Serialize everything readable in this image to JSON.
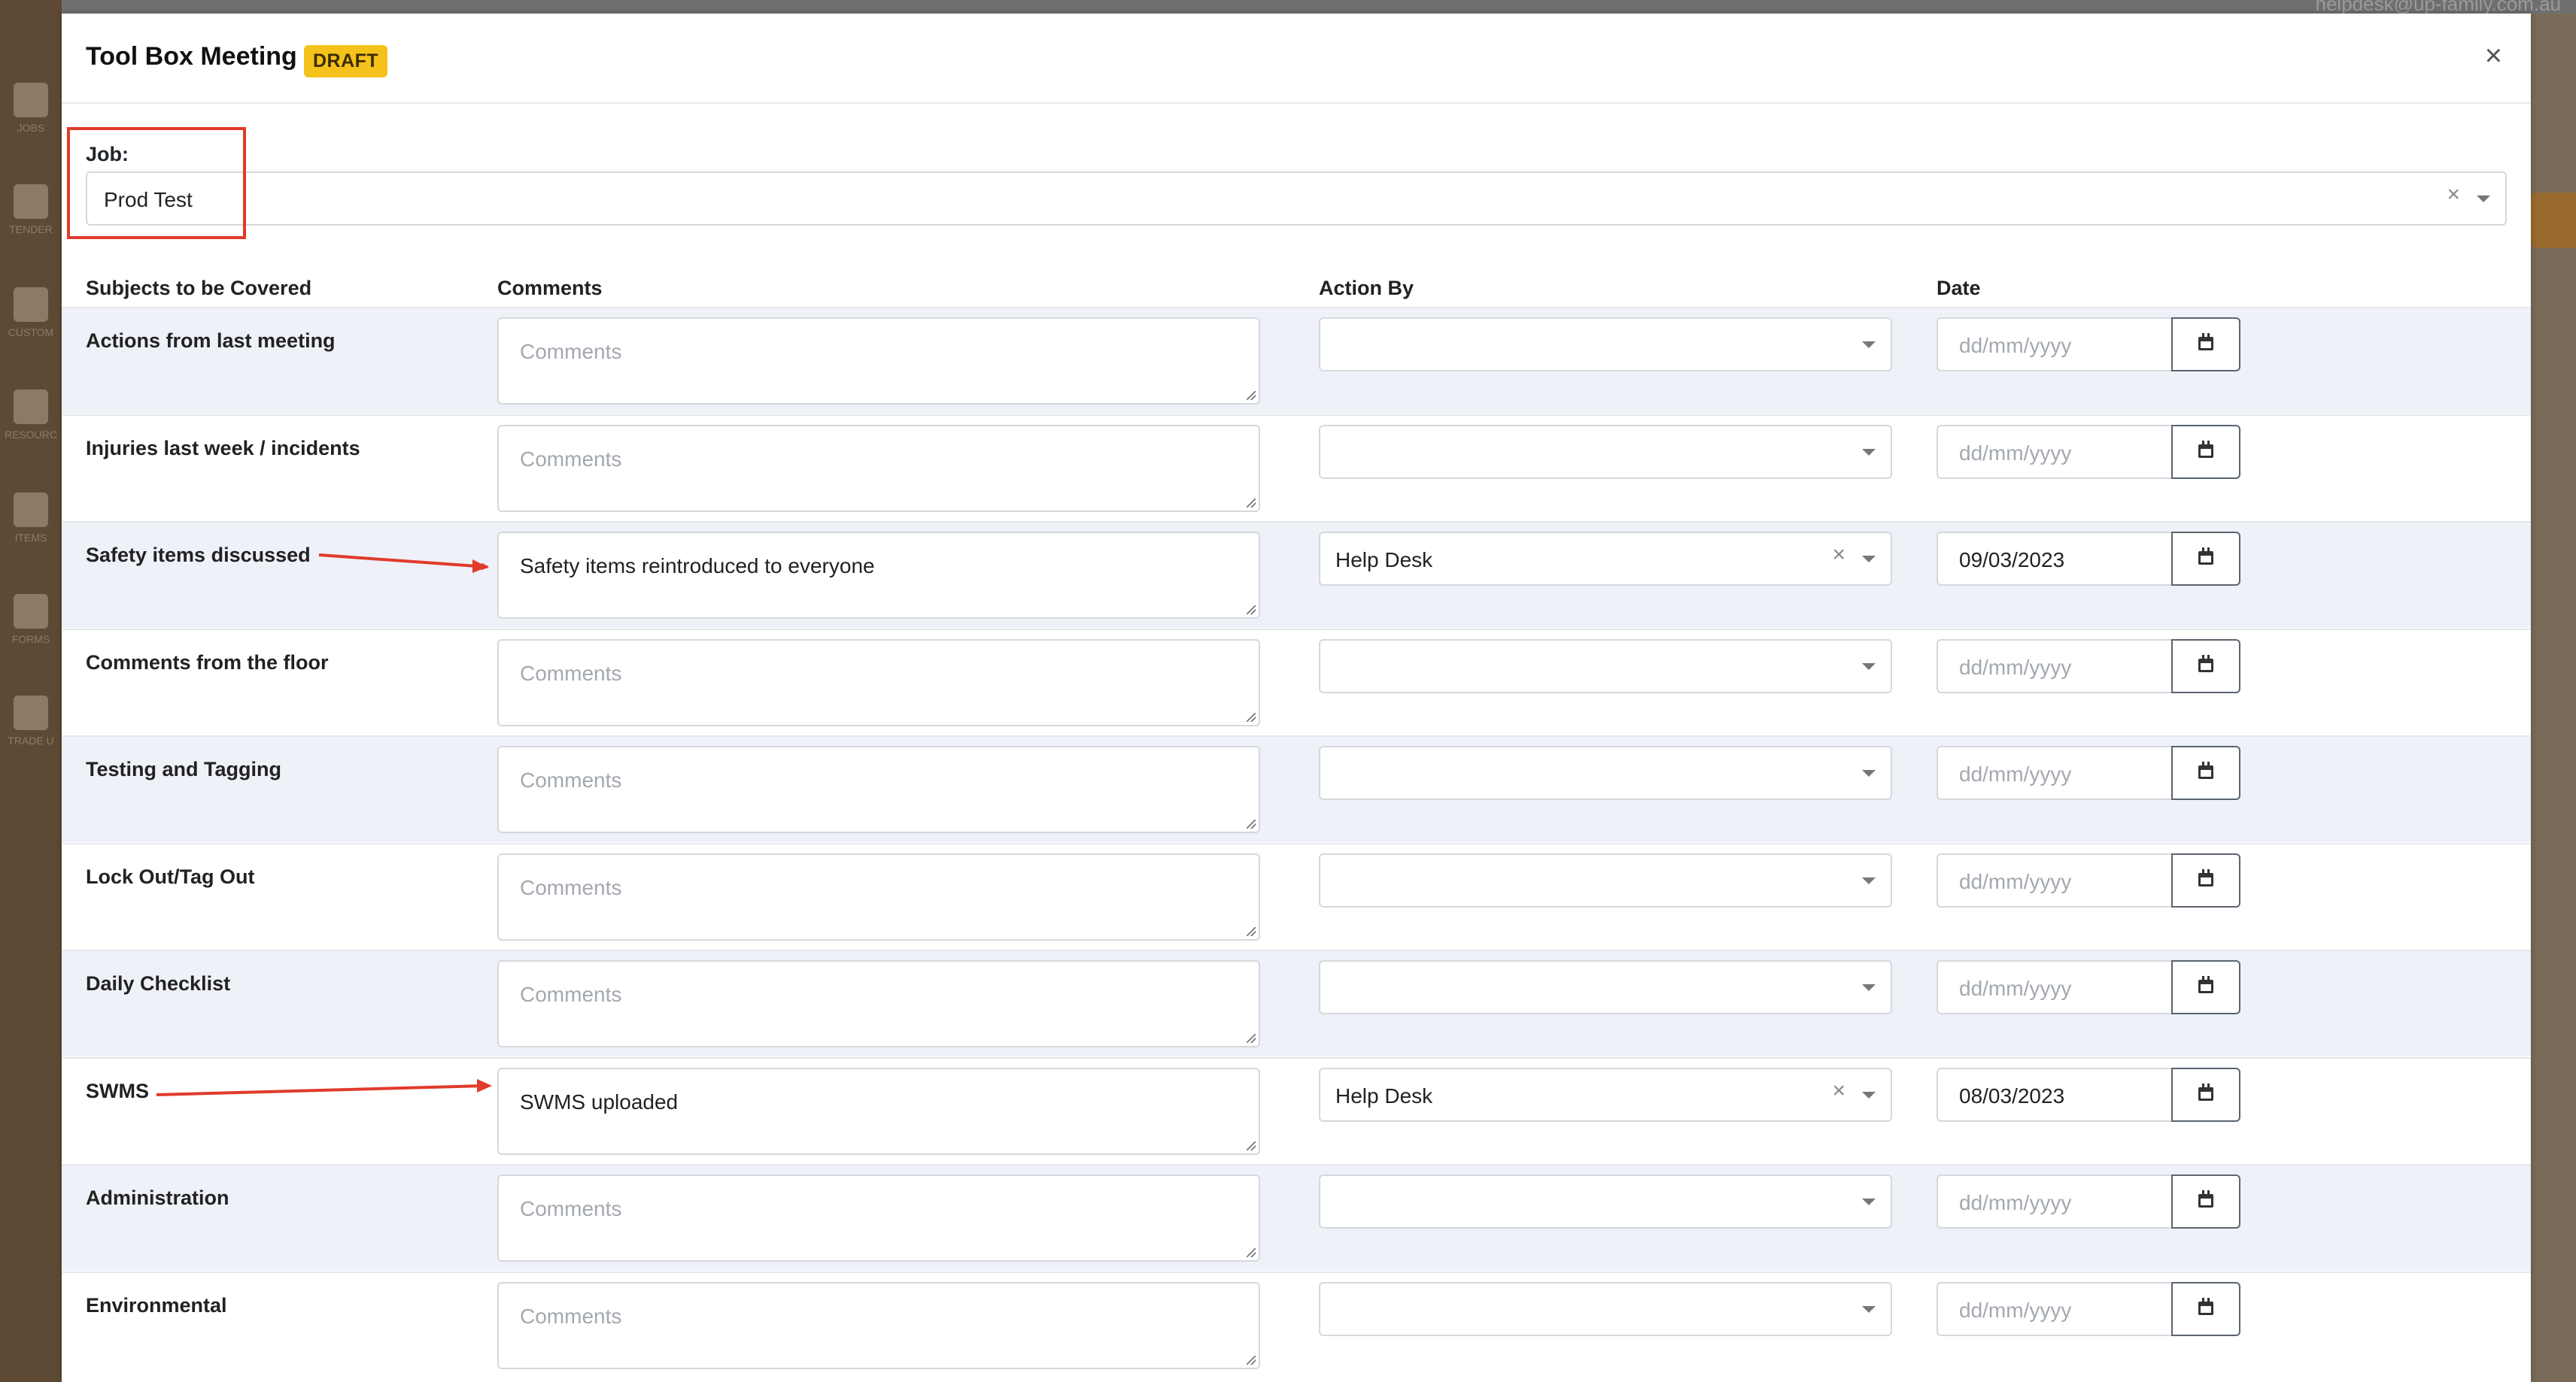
{
  "background": {
    "user_email": "helpdesk@up-family.com.au",
    "sidebar_items": [
      "JOBS",
      "TENDER",
      "CUSTOM",
      "RESOURC",
      "ITEMS",
      "FORMS",
      "TRADE U"
    ]
  },
  "modal": {
    "title": "Tool Box Meeting",
    "badge": "DRAFT",
    "close_glyph": "×"
  },
  "job": {
    "label": "Job:",
    "value": "Prod Test",
    "clear_glyph": "×"
  },
  "columns": {
    "subject": "Subjects to be Covered",
    "comments": "Comments",
    "action_by": "Action By",
    "date": "Date"
  },
  "placeholders": {
    "comments": "Comments",
    "date": "dd/mm/yyyy"
  },
  "rows": [
    {
      "subject": "Actions from last meeting",
      "comment": "",
      "action_by": "",
      "date": ""
    },
    {
      "subject": "Injuries last week / incidents",
      "comment": "",
      "action_by": "",
      "date": ""
    },
    {
      "subject": "Safety items discussed",
      "comment": "Safety items reintroduced to everyone",
      "action_by": "Help Desk",
      "date": "09/03/2023"
    },
    {
      "subject": "Comments from the floor",
      "comment": "",
      "action_by": "",
      "date": ""
    },
    {
      "subject": "Testing and Tagging",
      "comment": "",
      "action_by": "",
      "date": ""
    },
    {
      "subject": "Lock Out/Tag Out",
      "comment": "",
      "action_by": "",
      "date": ""
    },
    {
      "subject": "Daily Checklist",
      "comment": "",
      "action_by": "",
      "date": ""
    },
    {
      "subject": "SWMS",
      "comment": "SWMS uploaded",
      "action_by": "Help Desk",
      "date": "08/03/2023"
    },
    {
      "subject": "Administration",
      "comment": "",
      "action_by": "",
      "date": ""
    },
    {
      "subject": "Environmental",
      "comment": "",
      "action_by": "",
      "date": ""
    }
  ],
  "colors": {
    "badge": "#f5c21b",
    "annotation": "#e03b2b",
    "row_alt": "#eff1f8"
  }
}
